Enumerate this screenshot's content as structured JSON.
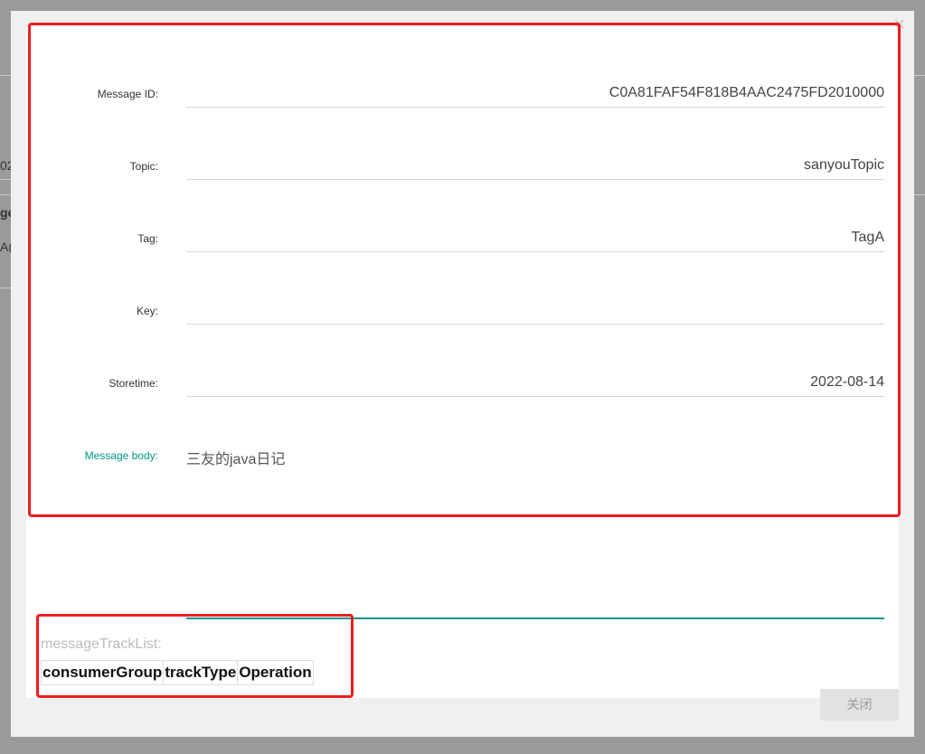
{
  "background": {
    "fragment_1": "02",
    "fragment_2": "ge",
    "fragment_3": "A("
  },
  "modal": {
    "close_icon": "×",
    "fields": [
      {
        "label": "Message ID:",
        "value": "C0A81FAF54F818B4AAC2475FD2010000"
      },
      {
        "label": "Topic:",
        "value": "sanyouTopic"
      },
      {
        "label": "Tag:",
        "value": "TagA"
      },
      {
        "label": "Key:",
        "value": ""
      },
      {
        "label": "Storetime:",
        "value": "2022-08-14"
      }
    ],
    "body_label": "Message body:",
    "body_value": "三友的java日记",
    "track_label": "messageTrackList:",
    "track_columns": [
      "consumerGroup",
      "trackType",
      "Operation"
    ],
    "close_button": "关闭"
  },
  "colors": {
    "accent": "#009688",
    "highlight": "#ee1c1c"
  }
}
